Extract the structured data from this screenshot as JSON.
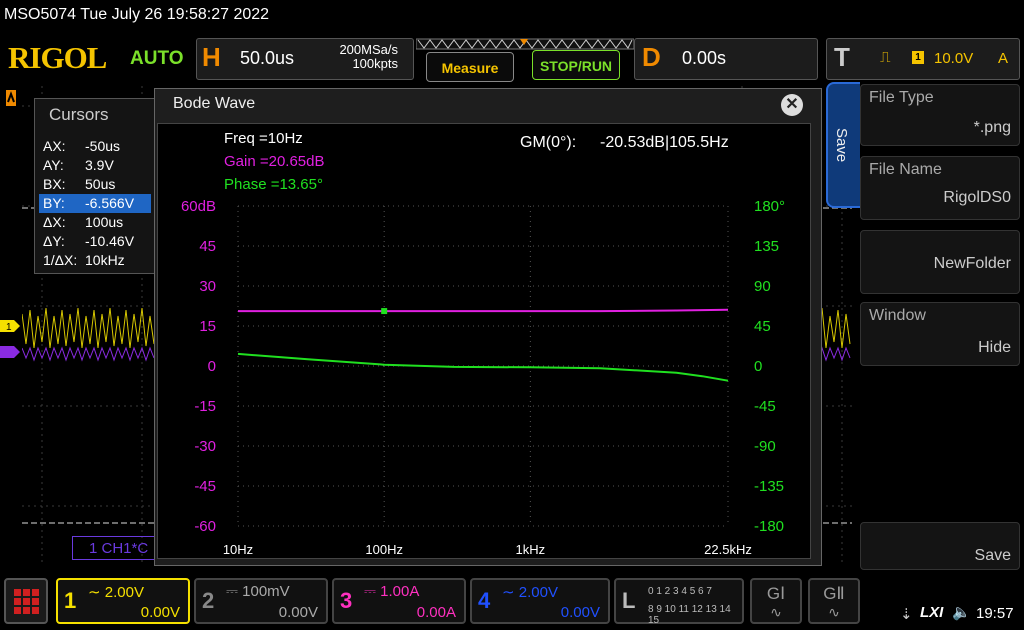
{
  "status_line": "MSO5074  Tue July 26 19:58:27 2022",
  "brand": "RIGOL",
  "run_mode": "AUTO",
  "horizontal": {
    "letter": "H",
    "timebase": "50.0us",
    "sample_rate": "200MSa/s",
    "memory_depth": "100kpts"
  },
  "buttons": {
    "measure": "Measure",
    "stop_run": "STOP/RUN"
  },
  "delay": {
    "letter": "D",
    "value": "0.00s"
  },
  "trigger": {
    "letter": "T",
    "source": "1",
    "level": "10.0V",
    "coupling": "A"
  },
  "cursors": {
    "title": "Cursors",
    "rows": [
      {
        "k": "AX:",
        "v": "-50us"
      },
      {
        "k": "AY:",
        "v": "3.9V"
      },
      {
        "k": "BX:",
        "v": "50us"
      },
      {
        "k": "BY:",
        "v": "-6.566V"
      },
      {
        "k": "ΔX:",
        "v": "100us"
      },
      {
        "k": "ΔY:",
        "v": "-10.46V"
      },
      {
        "k": "1/ΔX:",
        "v": "10kHz"
      }
    ],
    "selected_index": 3
  },
  "bode": {
    "title": "Bode Wave",
    "close": "✕",
    "freq": "Freq =10Hz",
    "gain": "Gain =20.65dB",
    "phase": "Phase =13.65°",
    "gm_label": "GM(0°):",
    "gm_value": "-20.53dB|105.5Hz",
    "left_ticks": [
      "60dB",
      "45",
      "30",
      "15",
      "0",
      "-15",
      "-30",
      "-45",
      "-60"
    ],
    "right_ticks": [
      "180°",
      "135",
      "90",
      "45",
      "0",
      "-45",
      "-90",
      "-135",
      "-180"
    ],
    "x_ticks": [
      "10Hz",
      "100Hz",
      "1kHz",
      "22.5kHz"
    ],
    "gain_color": "#e020e0",
    "phase_color": "#20e020"
  },
  "chart_data": {
    "type": "line",
    "x_scale": "log",
    "xlim": [
      10,
      22500
    ],
    "ylim_left": [
      -60,
      60
    ],
    "ylim_right": [
      -180,
      180
    ],
    "series": [
      {
        "axis": "left",
        "x": [
          10,
          30,
          100,
          300,
          1000,
          3000,
          10000,
          22500
        ],
        "values": [
          20.6,
          20.6,
          20.6,
          20.6,
          20.6,
          20.6,
          20.8,
          21.1
        ]
      },
      {
        "axis": "right",
        "x": [
          10,
          30,
          100,
          300,
          1000,
          3000,
          10000,
          15000,
          22500
        ],
        "values": [
          13.6,
          7.5,
          1.5,
          -1.0,
          -1.5,
          -2.5,
          -7.5,
          -11.5,
          -16.5
        ]
      }
    ]
  },
  "ch1_label": "1 CH1*C",
  "save_menu": {
    "tab": "Save",
    "items": [
      {
        "title": "File Type",
        "value": "*.png"
      },
      {
        "title": "File Name",
        "value": "RigolDS0"
      },
      {
        "title": "",
        "value": "NewFolder"
      },
      {
        "title": "Window",
        "value": "Hide"
      },
      {
        "title": "",
        "value": "Save"
      }
    ]
  },
  "channels": [
    {
      "num": "1",
      "volts": "2.00V",
      "offset": "0.00V",
      "color": "#f5e000",
      "active": true
    },
    {
      "num": "2",
      "volts": "100mV",
      "offset": "0.00V",
      "color": "#888888",
      "active": false
    },
    {
      "num": "3",
      "volts": "1.00A",
      "offset": "0.00A",
      "color": "#ff30c0",
      "active": false
    },
    {
      "num": "4",
      "volts": "2.00V",
      "offset": "0.00V",
      "color": "#2050ff",
      "active": false
    }
  ],
  "logic": {
    "letter": "L",
    "row1": "0 1 2 3  4 5 6 7",
    "row2": "8 9 10 11 12 13 14 15"
  },
  "generators": [
    "GⅠ",
    "GⅡ"
  ],
  "clock": "19:57",
  "lxi": "LXI"
}
